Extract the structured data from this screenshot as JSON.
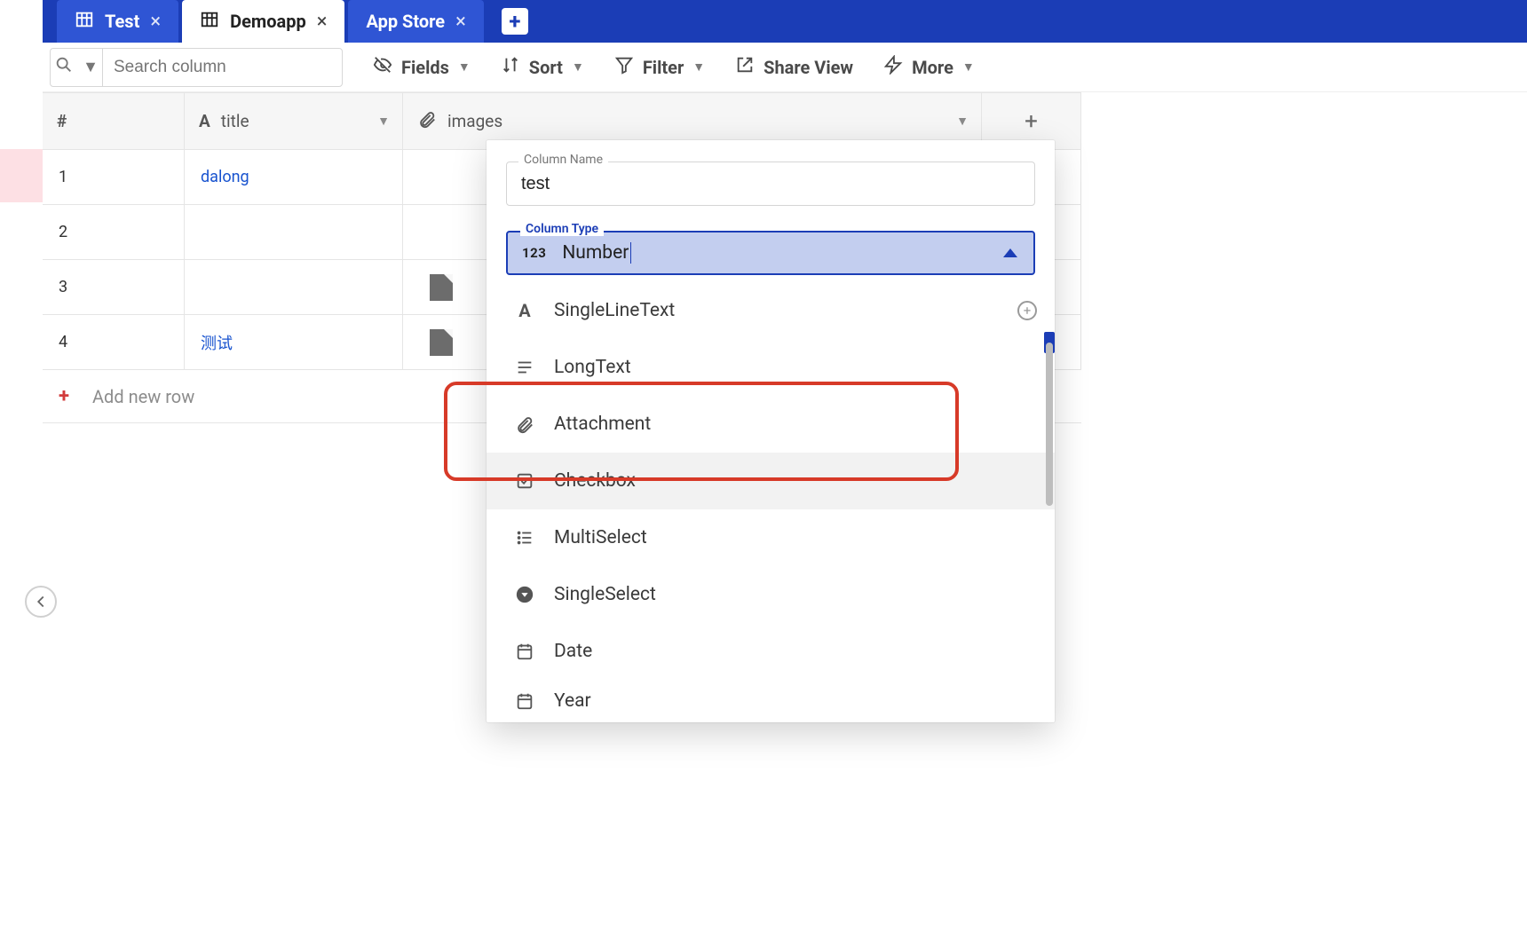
{
  "tabs": [
    {
      "label": "Test",
      "active": false
    },
    {
      "label": "Demoapp",
      "active": true
    },
    {
      "label": "App Store",
      "active": false
    }
  ],
  "search": {
    "placeholder": "Search column"
  },
  "toolbar": {
    "fields": "Fields",
    "sort": "Sort",
    "filter": "Filter",
    "share": "Share View",
    "more": "More"
  },
  "columns": {
    "num": "#",
    "title": "title",
    "images": "images"
  },
  "rows": [
    {
      "num": "1",
      "title": "dalong",
      "has_file": false
    },
    {
      "num": "2",
      "title": "",
      "has_file": false
    },
    {
      "num": "3",
      "title": "",
      "has_file": true
    },
    {
      "num": "4",
      "title": "测试",
      "has_file": true
    }
  ],
  "add_row_label": "Add new row",
  "column_popup": {
    "name_label": "Column Name",
    "name_value": "test",
    "type_label": "Column Type",
    "selected_type": "Number",
    "options": [
      {
        "label": "SingleLineText",
        "icon": "A",
        "has_add": true
      },
      {
        "label": "LongText",
        "icon": "≡"
      },
      {
        "label": "Attachment",
        "icon": "paperclip",
        "highlighted": true
      },
      {
        "label": "Checkbox",
        "icon": "check"
      },
      {
        "label": "MultiSelect",
        "icon": "list"
      },
      {
        "label": "SingleSelect",
        "icon": "circle-down"
      },
      {
        "label": "Date",
        "icon": "calendar"
      },
      {
        "label": "Year",
        "icon": "calendar"
      }
    ]
  }
}
